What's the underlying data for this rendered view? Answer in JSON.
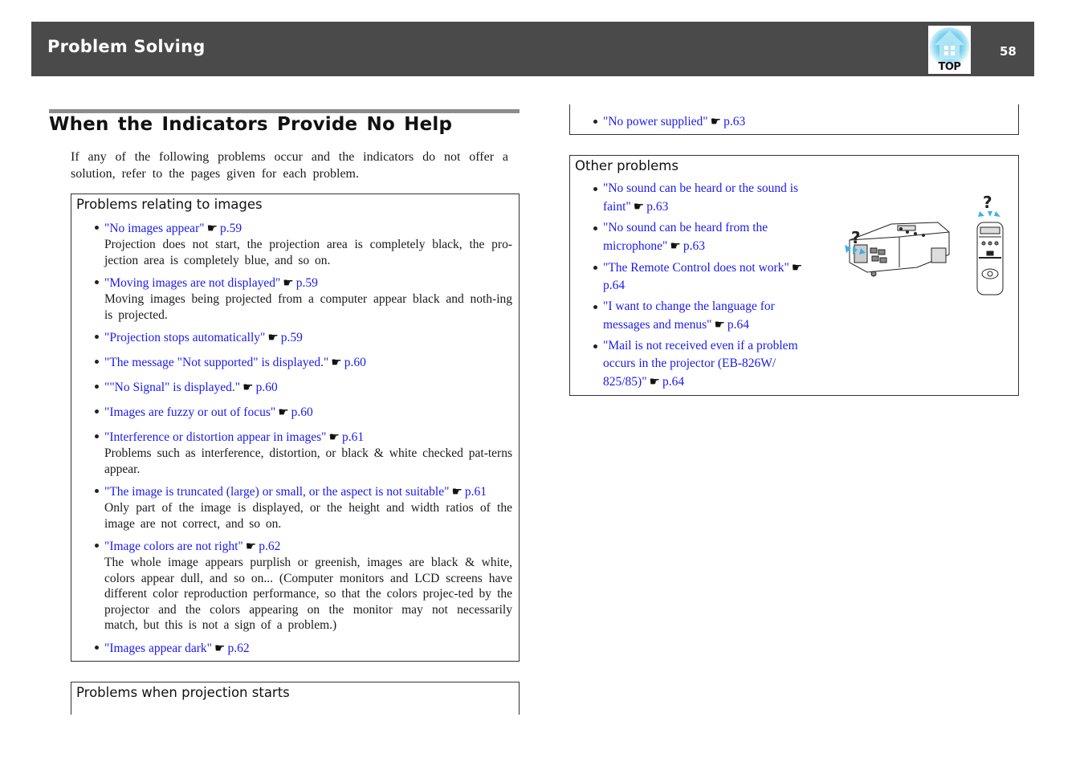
{
  "header": {
    "title": "Problem Solving",
    "top_button_label": "TOP",
    "page_number": "58"
  },
  "section": {
    "title": "When the Indicators Provide No Help",
    "intro": "If any of the following problems occur and the indicators do not offer a solution, refer to the pages given for each problem."
  },
  "ref_icon": "pointing-hand-icon",
  "boxes": {
    "images": {
      "title": "Problems relating to images",
      "items": [
        {
          "link": "\"No images appear\"",
          "page": "p.59",
          "desc": "Projection does not start, the projection area is completely black, the pro-jection area is completely blue, and so on."
        },
        {
          "link": "\"Moving images are not displayed\"",
          "page": "p.59",
          "desc": "Moving images being projected from a computer appear black and noth-ing is projected."
        },
        {
          "link": "\"Projection stops automatically\"",
          "page": "p.59"
        },
        {
          "link": "\"The message \"Not supported\" is displayed.\"",
          "page": "p.60"
        },
        {
          "link": "\"\"No Signal\" is displayed.\"",
          "page": "p.60"
        },
        {
          "link": "\"Images are fuzzy or out of focus\"",
          "page": "p.60"
        },
        {
          "link": "\"Interference or distortion appear in images\"",
          "page": "p.61",
          "desc": "Problems such as interference, distortion, or black & white checked pat-terns appear."
        },
        {
          "link": "\"The image is truncated (large) or small, or the aspect is not suitable\"",
          "page": "p.61",
          "desc": "Only part of the image is displayed, or the height and width ratios of the image are not correct, and so on."
        },
        {
          "link": "\"Image colors are not right\"",
          "page": "p.62",
          "desc": "The whole image appears purplish or greenish, images are black & white, colors appear dull, and so on... (Computer monitors and LCD screens have different color reproduction performance, so that the colors projec-ted by the projector and the colors appearing on the monitor may not necessarily match, but this is not a sign of a problem.)"
        },
        {
          "link": "\"Images appear dark\"",
          "page": "p.62"
        }
      ]
    },
    "projection_start": {
      "title": "Problems when projection starts"
    },
    "power": {
      "items": [
        {
          "link": "\"No power supplied\"",
          "page": "p.63"
        }
      ]
    },
    "other": {
      "title": "Other problems",
      "items": [
        {
          "link": "\"No sound can be heard or the sound is faint\"",
          "page": "p.63"
        },
        {
          "link": "\"No sound can be heard from the microphone\"",
          "page": "p.63"
        },
        {
          "link": "\"The Remote Control does not work\"",
          "page": "p.64"
        },
        {
          "link": "\"I want to change the language for messages and menus\"",
          "page": "p.64"
        },
        {
          "link": "\"Mail is not received even if a problem occurs in the projector (EB-826W/ 825/85)\"",
          "page": "p.64"
        }
      ],
      "illustration": "projector-and-remote-question-illustration"
    }
  },
  "colors": {
    "header_bg": "#4a4a4a",
    "link": "#1a1aee",
    "rule": "#8c8c8c",
    "top_icon": "#4fc3e8"
  }
}
